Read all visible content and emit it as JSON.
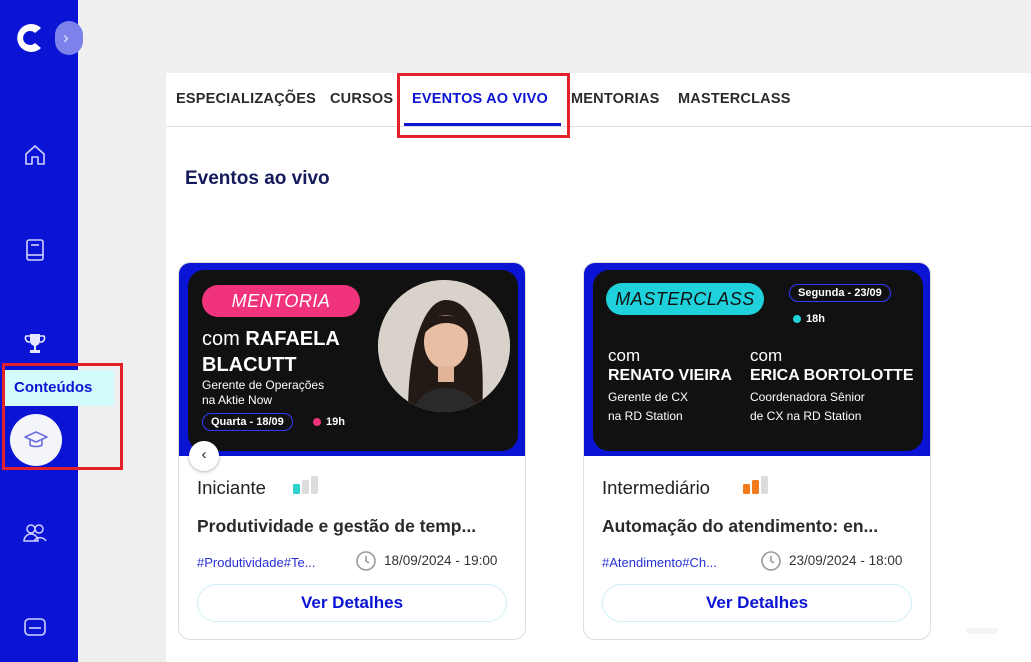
{
  "sidebar": {
    "tooltip_label": "Conteúdos",
    "items": [
      {
        "icon": "home-icon"
      },
      {
        "icon": "book-icon"
      },
      {
        "icon": "trophy-icon"
      },
      {
        "icon": "graduation-cap-icon"
      },
      {
        "icon": "users-icon"
      },
      {
        "icon": "card-icon"
      }
    ],
    "collapse_glyph": "›"
  },
  "tabs": [
    {
      "label": "ESPECIALIZAÇÕES"
    },
    {
      "label": "CURSOS"
    },
    {
      "label": "EVENTOS AO VIVO",
      "active": true
    },
    {
      "label": "MENTORIAS"
    },
    {
      "label": "MASTERCLASS"
    }
  ],
  "section_title": "Eventos ao vivo",
  "cards": [
    {
      "banner": {
        "tag": "MENTORIA",
        "com": "com",
        "name_line1": "RAFAELA",
        "name_line2": "BLACUTT",
        "role_line1": "Gerente de Operações",
        "role_line2": "na Aktie Now",
        "date": "Quarta - 18/09",
        "time": "19h"
      },
      "level": "Iniciante",
      "level_value": 1,
      "level_color": "#2fd1cc",
      "title": "Produtividade e gestão de temp...",
      "tags": "#Produtividade#Te...",
      "datetime": "18/09/2024 - 19:00",
      "button": "Ver Detalhes"
    },
    {
      "banner": {
        "tag": "MASTERCLASS",
        "date": "Segunda - 23/09",
        "time": "18h",
        "speaker1_com": "com",
        "speaker1_name": "RENATO VIEIRA",
        "speaker1_role1": "Gerente de CX",
        "speaker1_role2": "na RD Station",
        "speaker2_com": "com",
        "speaker2_name": "ERICA BORTOLOTTE",
        "speaker2_role1": "Coordenadora Sênior",
        "speaker2_role2": "de CX na RD Station"
      },
      "level": "Intermediário",
      "level_value": 2,
      "level_color": "#f07a1c",
      "title": "Automação do atendimento: en...",
      "tags": "#Atendimento#Ch...",
      "datetime": "23/09/2024 - 18:00",
      "button": "Ver Detalhes"
    }
  ],
  "carousel": {
    "prev_glyph": "‹"
  },
  "colors": {
    "brand": "#0b14d4",
    "highlight": "#e3212b",
    "mentoria": "#f0337a",
    "masterclass": "#1fd1da"
  }
}
